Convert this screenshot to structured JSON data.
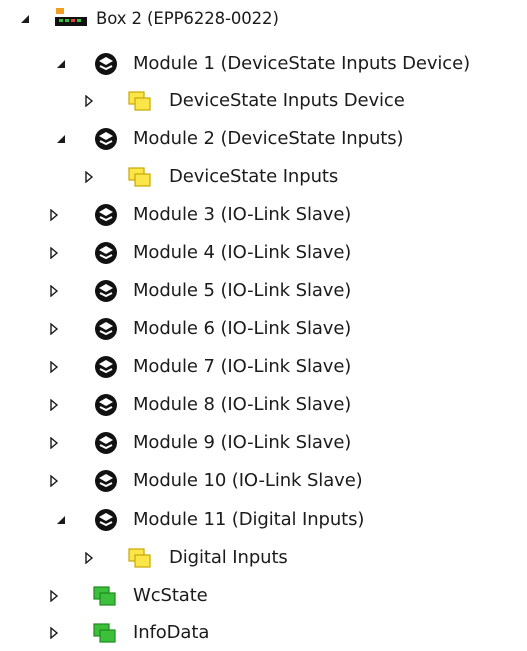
{
  "tree": {
    "root": {
      "label": "Box 2 (EPP6228-0022)",
      "icon": "ethercat-box-icon",
      "expanded": true
    },
    "modules": [
      {
        "label": "Module 1 (DeviceState Inputs Device)",
        "icon": "module-icon",
        "expanded": true,
        "child": {
          "label": "DeviceState Inputs Device",
          "icon": "input-variables-icon",
          "expanded": false
        }
      },
      {
        "label": "Module 2 (DeviceState Inputs)",
        "icon": "module-icon",
        "expanded": true,
        "child": {
          "label": "DeviceState Inputs",
          "icon": "input-variables-icon",
          "expanded": false
        }
      },
      {
        "label": "Module 3 (IO-Link Slave)",
        "icon": "module-icon",
        "expanded": false
      },
      {
        "label": "Module 4 (IO-Link Slave)",
        "icon": "module-icon",
        "expanded": false
      },
      {
        "label": "Module 5 (IO-Link Slave)",
        "icon": "module-icon",
        "expanded": false
      },
      {
        "label": "Module 6 (IO-Link Slave)",
        "icon": "module-icon",
        "expanded": false
      },
      {
        "label": "Module 7 (IO-Link Slave)",
        "icon": "module-icon",
        "expanded": false
      },
      {
        "label": "Module 8 (IO-Link Slave)",
        "icon": "module-icon",
        "expanded": false
      },
      {
        "label": "Module 9 (IO-Link Slave)",
        "icon": "module-icon",
        "expanded": false
      },
      {
        "label": "Module 10 (IO-Link Slave)",
        "icon": "module-icon",
        "expanded": false
      },
      {
        "label": "Module 11 (Digital Inputs)",
        "icon": "module-icon",
        "expanded": true,
        "child": {
          "label": "Digital Inputs",
          "icon": "input-variables-icon",
          "expanded": false
        }
      }
    ],
    "status_items": [
      {
        "label": "WcState",
        "icon": "status-variables-icon",
        "expanded": false
      },
      {
        "label": "InfoData",
        "icon": "status-variables-icon",
        "expanded": false
      }
    ],
    "colors": {
      "input_icon_fill": "#fbe64a",
      "input_icon_stroke": "#c9a800",
      "status_icon_fill": "#3cc03c",
      "status_icon_stroke": "#1f8a1f",
      "box_icon_orange": "#f0a020",
      "box_icon_green": "#38c038"
    }
  }
}
